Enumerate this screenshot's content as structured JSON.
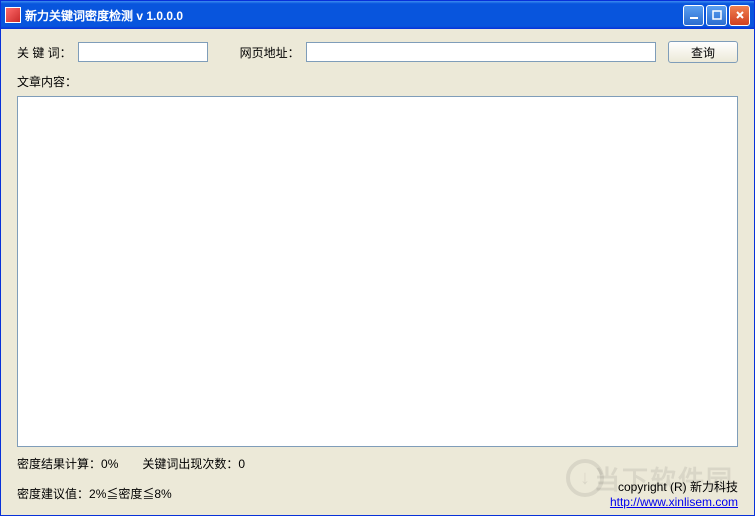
{
  "window": {
    "title": "新力关键词密度检测  v 1.0.0.0"
  },
  "form": {
    "keyword_label": "关 键 词：",
    "keyword_value": "",
    "url_label": "网页地址：",
    "url_value": "",
    "query_button": "查询",
    "content_label": "文章内容：",
    "content_value": ""
  },
  "status": {
    "density_result_label": "密度结果计算：",
    "density_result_value": "0%",
    "keyword_count_label": "关键词出现次数：",
    "keyword_count_value": "0",
    "recommend_label": "密度建议值：",
    "recommend_value": "2%≦密度≦8%"
  },
  "footer": {
    "copyright_text": "copyright (R) 新力科技",
    "link_text": "http://www.xinlisem.com"
  },
  "watermark": "当下软件园"
}
